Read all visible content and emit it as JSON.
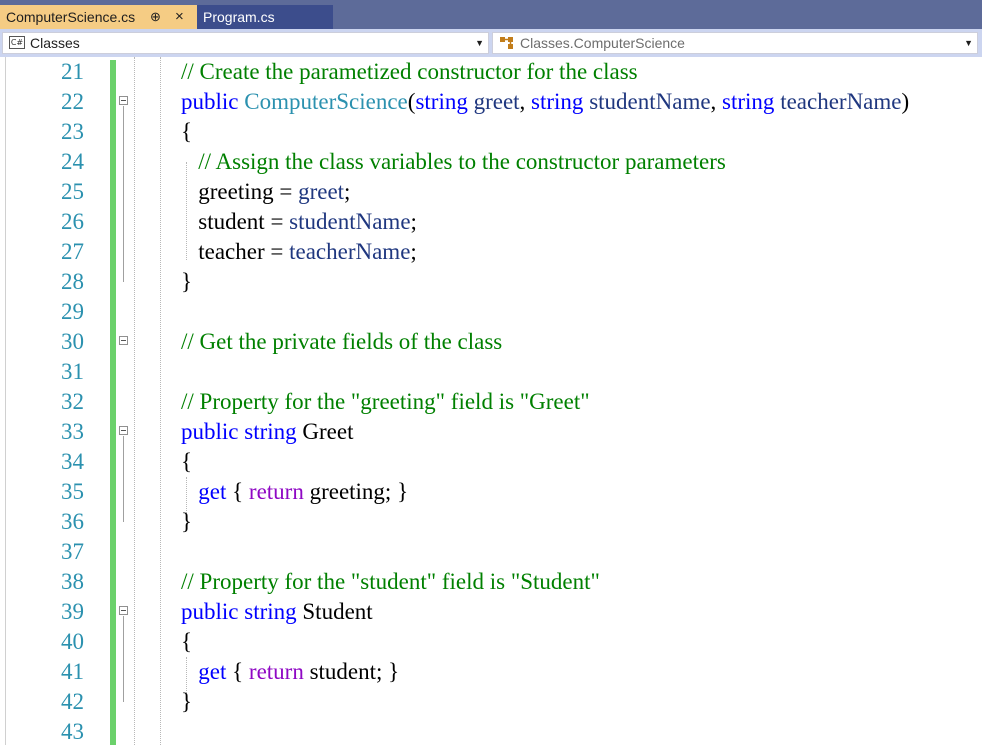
{
  "tabs": {
    "active": {
      "label": "ComputerScience.cs",
      "pin": "⊕",
      "close": "×"
    },
    "inactive": {
      "label": "Program.cs"
    }
  },
  "navbar": {
    "left": {
      "icon": "C#",
      "label": "Classes",
      "arrow": "▼"
    },
    "right": {
      "label": "Classes.ComputerScience",
      "arrow": "▼"
    }
  },
  "colors": {
    "keyword": "#0000ff",
    "control_keyword": "#8f08c4",
    "type": "#2b91af",
    "parameter": "#1f377f",
    "comment": "#008000",
    "line_number": "#2b91af",
    "change_bar": "#6bd16b"
  },
  "lines": [
    {
      "n": "21",
      "segments": [
        [
          "// Create the parametized constructor for the class",
          "cm"
        ]
      ]
    },
    {
      "n": "22",
      "segments": [
        [
          "public",
          "kw"
        ],
        [
          " ",
          "ident"
        ],
        [
          "ComputerScience",
          "type"
        ],
        [
          "(",
          "ident"
        ],
        [
          "string",
          "kw"
        ],
        [
          " ",
          "ident"
        ],
        [
          "greet",
          "param"
        ],
        [
          ", ",
          "ident"
        ],
        [
          "string",
          "kw"
        ],
        [
          " ",
          "ident"
        ],
        [
          "studentName",
          "param"
        ],
        [
          ", ",
          "ident"
        ],
        [
          "string",
          "kw"
        ],
        [
          " ",
          "ident"
        ],
        [
          "teacherName",
          "param"
        ],
        [
          ")",
          "ident"
        ]
      ]
    },
    {
      "n": "23",
      "segments": [
        [
          "{",
          "ident"
        ]
      ]
    },
    {
      "n": "24",
      "segments": [
        [
          "   // Assign the class variables to the constructor parameters",
          "cm"
        ]
      ]
    },
    {
      "n": "25",
      "segments": [
        [
          "   greeting = ",
          "ident"
        ],
        [
          "greet",
          "param"
        ],
        [
          ";",
          "ident"
        ]
      ]
    },
    {
      "n": "26",
      "segments": [
        [
          "   student = ",
          "ident"
        ],
        [
          "studentName",
          "param"
        ],
        [
          ";",
          "ident"
        ]
      ]
    },
    {
      "n": "27",
      "segments": [
        [
          "   teacher = ",
          "ident"
        ],
        [
          "teacherName",
          "param"
        ],
        [
          ";",
          "ident"
        ]
      ]
    },
    {
      "n": "28",
      "segments": [
        [
          "}",
          "ident"
        ]
      ]
    },
    {
      "n": "29",
      "segments": []
    },
    {
      "n": "30",
      "segments": [
        [
          "// Get the private fields of the class",
          "cm"
        ]
      ]
    },
    {
      "n": "31",
      "segments": []
    },
    {
      "n": "32",
      "segments": [
        [
          "// Property for the \"greeting\" field is \"Greet\"",
          "cm"
        ]
      ]
    },
    {
      "n": "33",
      "segments": [
        [
          "public",
          "kw"
        ],
        [
          " ",
          "ident"
        ],
        [
          "string",
          "kw"
        ],
        [
          " Greet",
          "ident"
        ]
      ]
    },
    {
      "n": "34",
      "segments": [
        [
          "{",
          "ident"
        ]
      ]
    },
    {
      "n": "35",
      "segments": [
        [
          "   ",
          "ident"
        ],
        [
          "get",
          "kw"
        ],
        [
          " { ",
          "ident"
        ],
        [
          "return",
          "kw2"
        ],
        [
          " greeting; }",
          "ident"
        ]
      ]
    },
    {
      "n": "36",
      "segments": [
        [
          "}",
          "ident"
        ]
      ]
    },
    {
      "n": "37",
      "segments": []
    },
    {
      "n": "38",
      "segments": [
        [
          "// Property for the \"student\" field is \"Student\"",
          "cm"
        ]
      ]
    },
    {
      "n": "39",
      "segments": [
        [
          "public",
          "kw"
        ],
        [
          " ",
          "ident"
        ],
        [
          "string",
          "kw"
        ],
        [
          " Student",
          "ident"
        ]
      ]
    },
    {
      "n": "40",
      "segments": [
        [
          "{",
          "ident"
        ]
      ]
    },
    {
      "n": "41",
      "segments": [
        [
          "   ",
          "ident"
        ],
        [
          "get",
          "kw"
        ],
        [
          " { ",
          "ident"
        ],
        [
          "return",
          "kw2"
        ],
        [
          " student; }",
          "ident"
        ]
      ]
    },
    {
      "n": "42",
      "segments": [
        [
          "}",
          "ident"
        ]
      ]
    },
    {
      "n": "43",
      "segments": []
    }
  ],
  "fold_markers": [
    "22",
    "30",
    "33",
    "39"
  ]
}
